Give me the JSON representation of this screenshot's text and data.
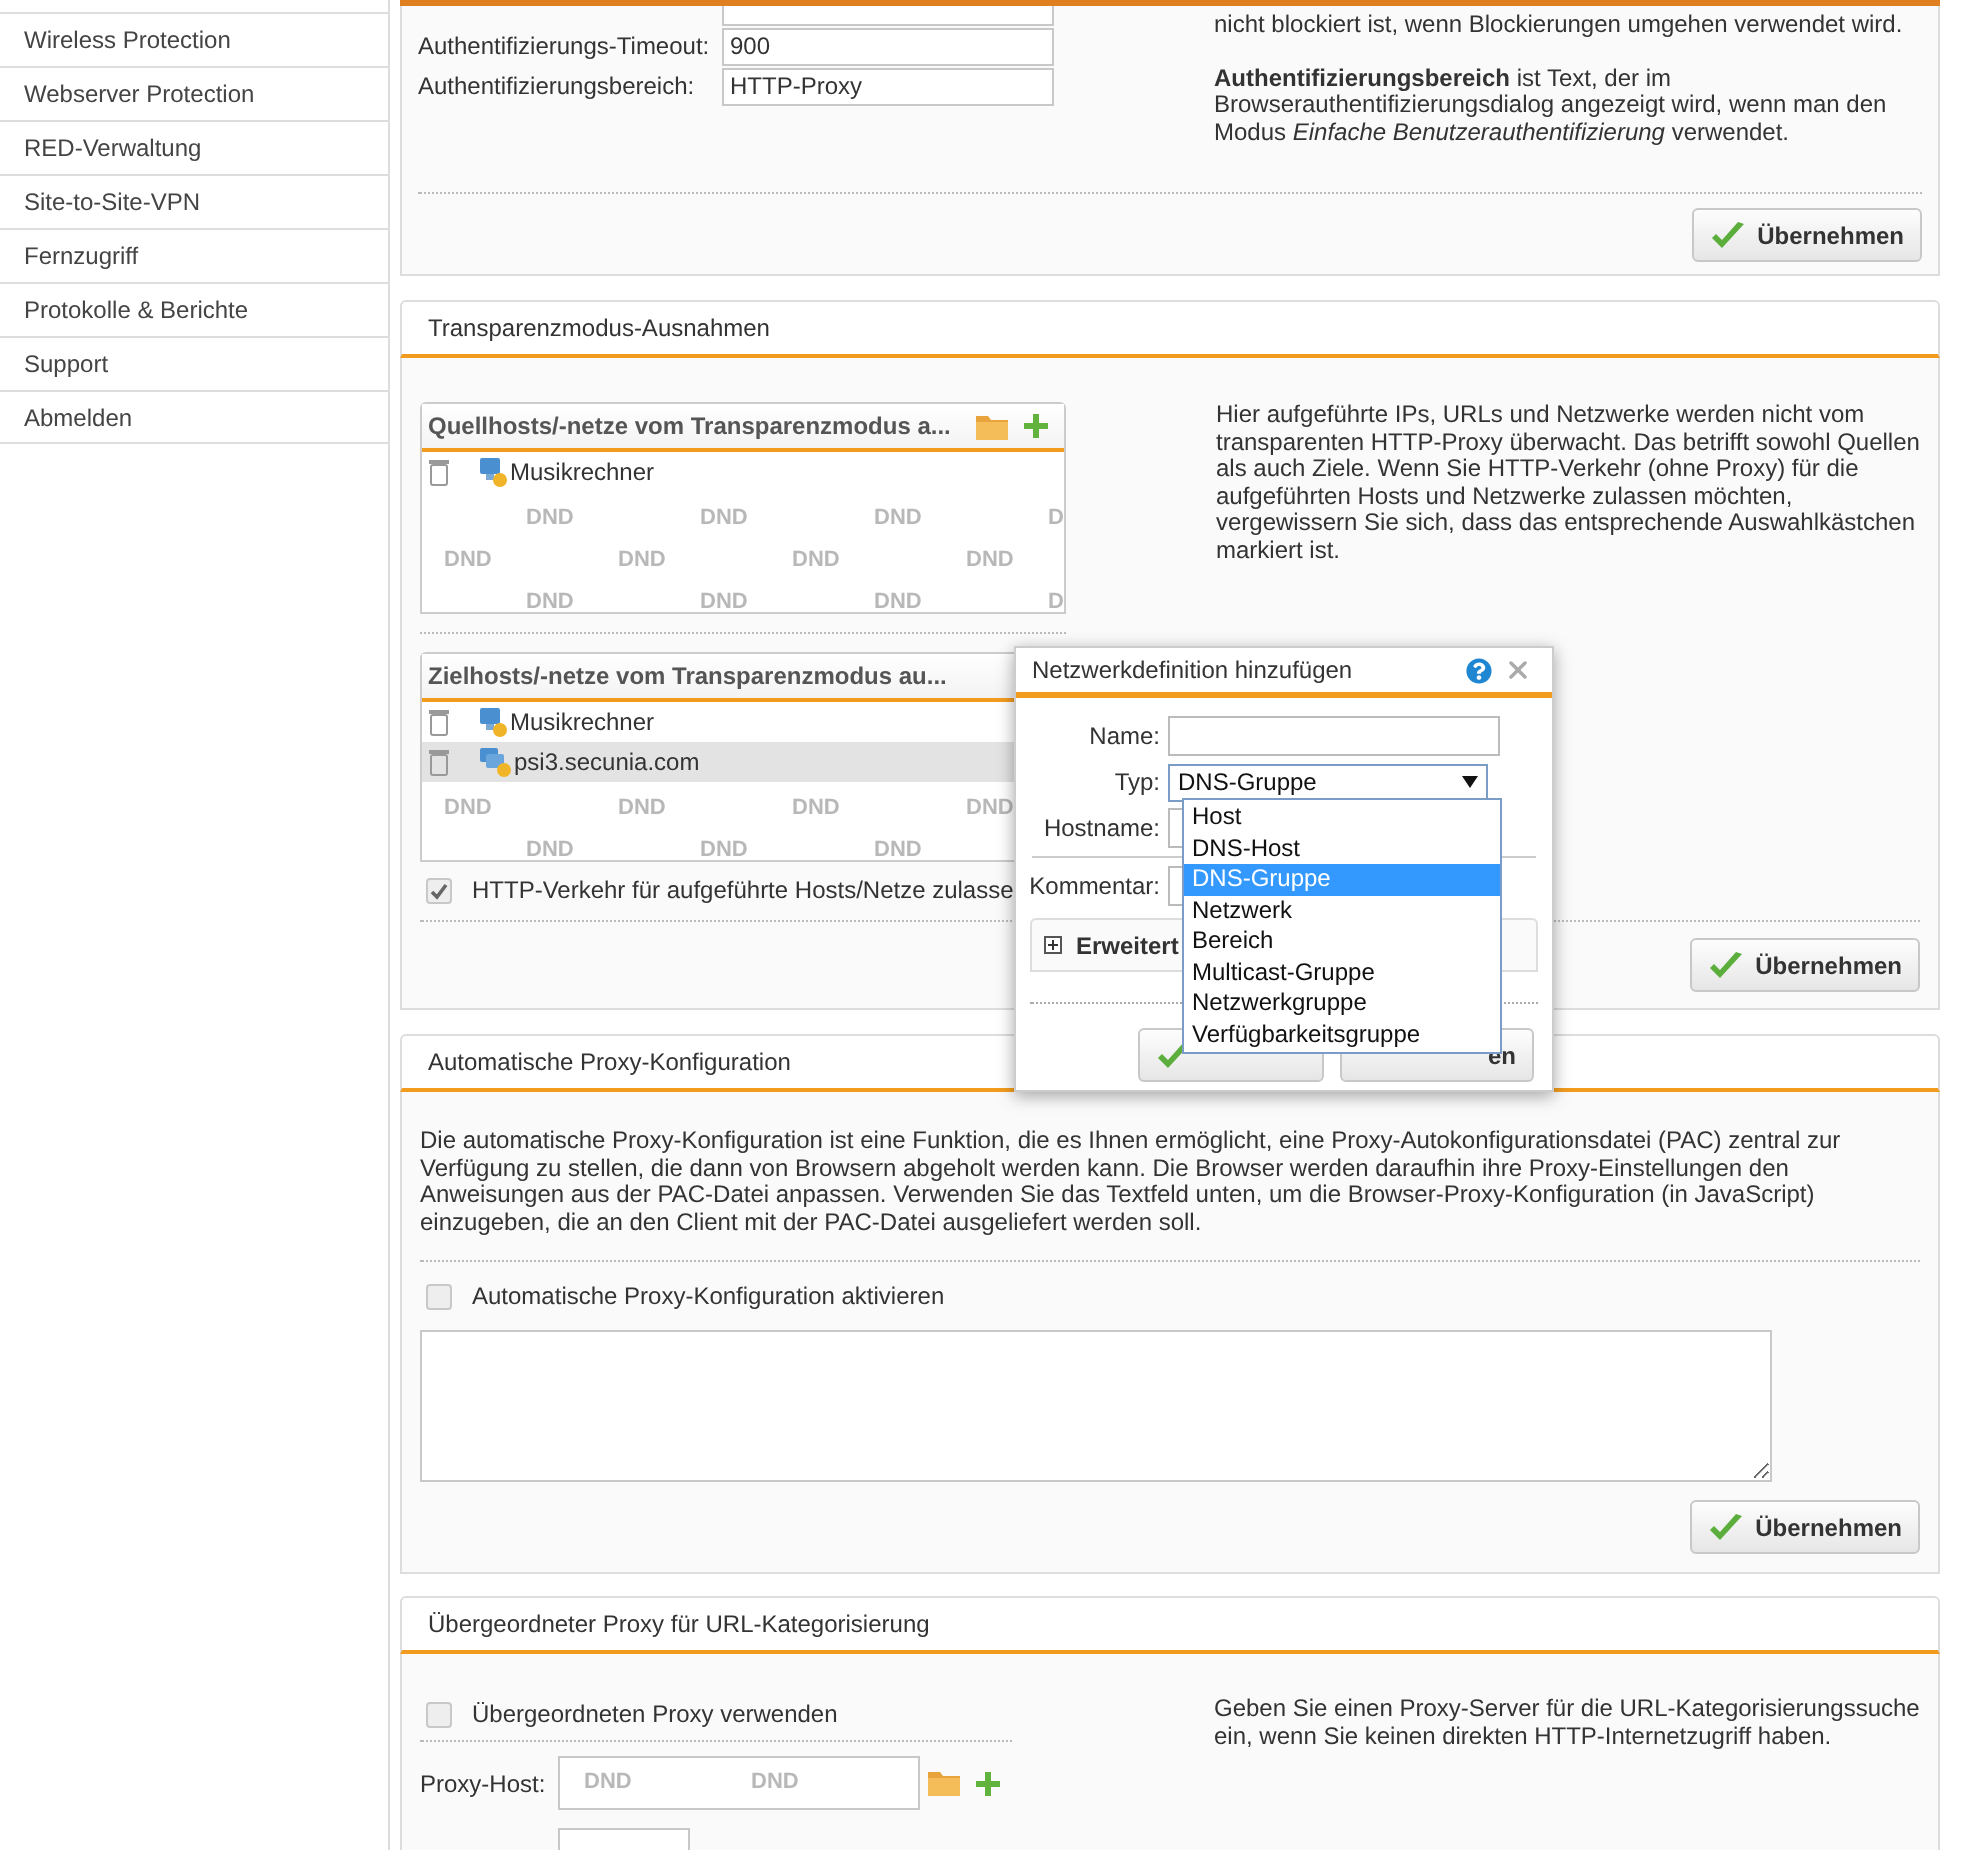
{
  "sidebar": {
    "items": [
      "Wireless Protection",
      "Webserver Protection",
      "RED-Verwaltung",
      "Site-to-Site-VPN",
      "Fernzugriff",
      "Protokolle & Berichte",
      "Support",
      "Abmelden"
    ]
  },
  "auth_panel": {
    "fields": [
      {
        "label": "Authentifizierungs-Timeout:",
        "value": "900"
      },
      {
        "label": "Authentifizierungsbereich:",
        "value": "HTTP-Proxy"
      }
    ],
    "help": [
      "nicht blockiert ist, wenn Blockierungen umgehen verwendet wird.",
      "**Authentifizierungsbereich** ist Text, der im Browserauthentifizierungsdialog angezeigt wird, wenn man den Modus *Einfache Benutzerauthentifizierung* verwendet."
    ],
    "button": "Übernehmen"
  },
  "transparency_panel": {
    "title": "Transparenzmodus-Ausnahmen",
    "lists": [
      {
        "title": "Quellhosts/-netze vom Transparenzmodus a...",
        "add": true,
        "items": [
          {
            "kind": "host",
            "label": "Musikrechner",
            "selected": false
          }
        ],
        "drop_marks": [
          [
            "DND",
            "DND",
            "DND",
            "D"
          ],
          [
            "DND",
            "DND",
            "DND",
            "DND"
          ],
          [
            "DND",
            "DND",
            "DND",
            "D"
          ]
        ]
      },
      {
        "title": "Zielhosts/-netze vom Transparenzmodus au...",
        "add": false,
        "items": [
          {
            "kind": "host",
            "label": "Musikrechner",
            "selected": false
          },
          {
            "kind": "dns_group",
            "label": "psi3.secunia.com",
            "selected": true
          }
        ],
        "drop_marks": [
          [
            "DND",
            "DND",
            "DND",
            "DND"
          ],
          [
            "DND",
            "DND",
            "DND"
          ]
        ]
      }
    ],
    "allow": {
      "label": "HTTP-Verkehr für aufgeführte Hosts/Netze zulasse",
      "checked": true
    },
    "help": "Hier aufgeführte IPs, URLs und Netzwerke werden nicht vom transparenten HTTP-Proxy überwacht. Das betrifft sowohl Quellen als auch Ziele. Wenn Sie HTTP-Verkehr (ohne Proxy) für die aufgeführten Hosts und Netzwerke zulassen möchten, vergewissern Sie sich, dass das entsprechende Auswahlkästchen markiert ist.",
    "button": "Übernehmen"
  },
  "pac_panel": {
    "title": "Automatische Proxy-Konfiguration",
    "text": "Die automatische Proxy-Konfiguration ist eine Funktion, die es Ihnen ermöglicht, eine Proxy-Autokonfigurationsdatei (PAC) zentral zur Verfügung zu stellen, die dann von Browsern abgeholt werden kann. Die Browser werden daraufhin ihre Proxy-Einstellungen den Anweisungen aus der PAC-Datei anpassen. Verwenden Sie das Textfeld unten, um die Browser-Proxy-Konfiguration (in JavaScript) einzugeben, die an den Client mit der PAC-Datei ausgeliefert werden soll.",
    "enable": {
      "label": "Automatische Proxy-Konfiguration aktivieren",
      "checked": false
    },
    "button": "Übernehmen"
  },
  "parent_proxy_panel": {
    "title": "Übergeordneter Proxy für URL-Kategorisierung",
    "enable": {
      "label": "Übergeordneten Proxy verwenden",
      "checked": false
    },
    "host_label": "Proxy-Host:",
    "host_marks": [
      "DND",
      "DND"
    ],
    "help": "Geben Sie einen Proxy-Server für die URL-Kategorisierungssuche ein, wenn Sie keinen direkten HTTP-Internetzugriff haben."
  },
  "dialog": {
    "title": "Netzwerkdefinition hinzufügen",
    "name_label": "Name:",
    "type_label": "Typ:",
    "type_value": "DNS-Gruppe",
    "hostname_label": "Hostname:",
    "comment_label": "Kommentar:",
    "advanced": "Erweitert",
    "options": [
      {
        "label": "Host",
        "selected": false
      },
      {
        "label": "DNS-Host",
        "selected": false
      },
      {
        "label": "DNS-Gruppe",
        "selected": true
      },
      {
        "label": "Netzwerk",
        "selected": false
      },
      {
        "label": "Bereich",
        "selected": false
      },
      {
        "label": "Multicast-Gruppe",
        "selected": false
      },
      {
        "label": "Netzwerkgruppe",
        "selected": false
      },
      {
        "label": "Verfügbarkeitsgruppe",
        "selected": false
      }
    ],
    "cancel": "en"
  }
}
